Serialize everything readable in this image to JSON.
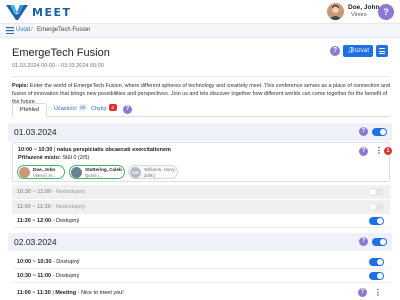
{
  "app": {
    "logo_text": "MEET"
  },
  "user": {
    "name": "Doe, John",
    "org": "Vireeo",
    "help_glyph": "?"
  },
  "breadcrumb": {
    "home": "Úvod",
    "separator": "/",
    "current": "EmergeTech Fusion"
  },
  "event": {
    "title": "EmergeTech Fusion",
    "dates": "01.03.2024 00:00 – 03.03.2024 00:00",
    "invite_label": "Pozvat",
    "description_label": "Popis:",
    "description": "Enter the world of EmergeTech Fusion, where different spheres of technology and creativity meet. This conference serves as a place of connection and fusion of innovation that brings new possibilities and perspectives. Join us and lets discover together how different worlds can come together for the benefit of the future."
  },
  "tabs": [
    {
      "label": "Přehled",
      "badge": ""
    },
    {
      "label": "Účastníci",
      "badge": "20"
    },
    {
      "label": "Chyby",
      "badge": "4"
    }
  ],
  "days": [
    {
      "date": "01.03.2024",
      "featured": {
        "time": "10:00 ~ 10:30",
        "title": "natus perspiciatis obcaecati exercitationem",
        "seats_label": "Přiřazené místo:",
        "seats_value": "Stůl 0 (2/5)",
        "alert": "1",
        "attendees": [
          {
            "name": "Doe, John",
            "sub": "Vireeo | Ar...",
            "style": "green",
            "avatar_color": "#c89a76"
          },
          {
            "name": "Stuttering, Caleb",
            "sub": "Quora | ...",
            "style": "green",
            "avatar_color": "#6d7f96"
          },
          {
            "name": "Williams, Harry",
            "sub": "Zolis |",
            "initials": "WH",
            "style": "grey"
          }
        ]
      },
      "sessions": [
        {
          "time": "10:30 ~ 11:00",
          "status": "Nedostupný",
          "enabled": false
        },
        {
          "time": "11:00 ~ 11:30",
          "status": "Nedostupný",
          "enabled": false
        },
        {
          "time": "11:30 ~ 12:00",
          "status": "Dostupný",
          "enabled": true
        }
      ]
    },
    {
      "date": "02.03.2024",
      "sessions": [
        {
          "time": "10:00 ~ 10:30",
          "status": "Dostupný",
          "enabled": true
        },
        {
          "time": "10:30 ~ 11:00",
          "status": "Dostupný",
          "enabled": true
        },
        {
          "time": "11:00 ~ 11:30",
          "meeting": "Meeting",
          "status": "Nice to meet you!",
          "enabled": true
        }
      ]
    }
  ],
  "colors": {
    "primary": "#1f6fe5",
    "help": "#8e78d4",
    "alert": "#e03131",
    "accepted": "#48b66a"
  }
}
